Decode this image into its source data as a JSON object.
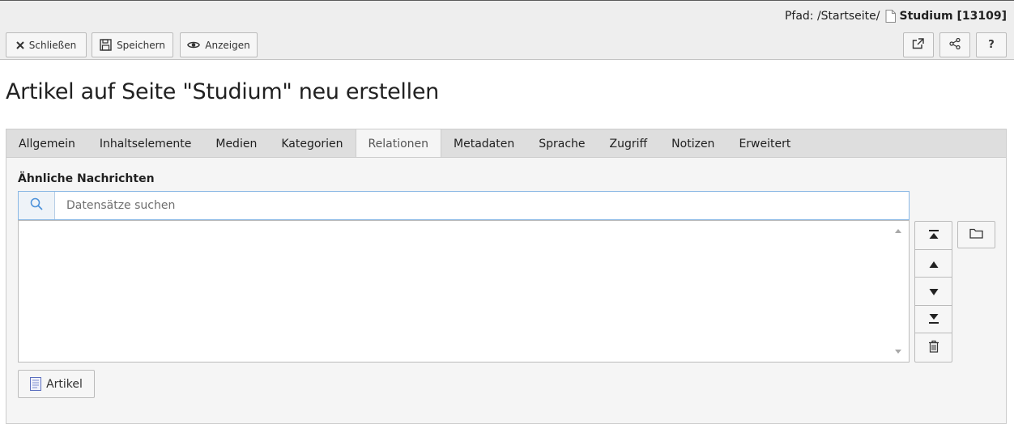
{
  "header": {
    "path_label": "Pfad: /Startseite/",
    "page_title": "Studium [13109]"
  },
  "toolbar": {
    "close_label": "Schließen",
    "save_label": "Speichern",
    "view_label": "Anzeigen",
    "help_label": "?"
  },
  "page": {
    "heading": "Artikel auf Seite \"Studium\" neu erstellen"
  },
  "tabs": [
    {
      "label": "Allgemein"
    },
    {
      "label": "Inhaltselemente"
    },
    {
      "label": "Medien"
    },
    {
      "label": "Kategorien"
    },
    {
      "label": "Relationen",
      "active": true
    },
    {
      "label": "Metadaten"
    },
    {
      "label": "Sprache"
    },
    {
      "label": "Zugriff"
    },
    {
      "label": "Notizen"
    },
    {
      "label": "Erweitert"
    }
  ],
  "field": {
    "label": "Ähnliche Nachrichten",
    "search_placeholder": "Datensätze suchen",
    "search_value": "",
    "add_label": "Artikel"
  },
  "colors": {
    "accent": "#89b7e4",
    "header_bg": "#eeeeee",
    "panel_bg": "#f5f5f5"
  },
  "icons": {
    "close": "close-icon",
    "save": "save-icon",
    "view": "eye-icon",
    "open": "external-link-icon",
    "share": "share-icon",
    "search": "search-icon",
    "move_top": "move-top-icon",
    "move_up": "move-up-icon",
    "move_down": "move-down-icon",
    "move_bottom": "move-bottom-icon",
    "delete": "trash-icon",
    "browse": "folder-icon",
    "record": "document-icon"
  }
}
